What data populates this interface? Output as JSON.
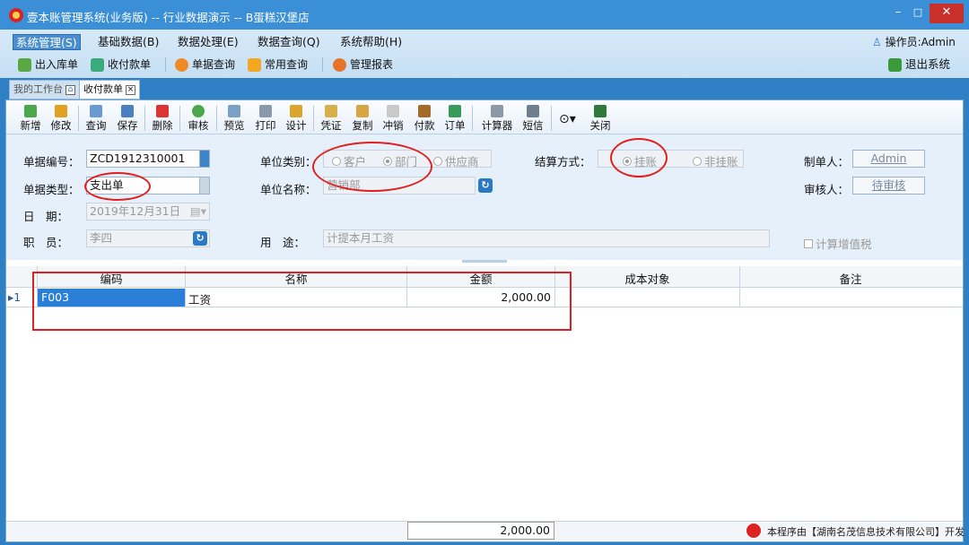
{
  "window": {
    "title": "壹本账管理系统(业务版) -- 行业数据演示 -- B蛋糕汉堡店",
    "minimize": "–",
    "maximize": "□",
    "close": "✕"
  },
  "menu": {
    "items": [
      {
        "label": "系统管理(S)"
      },
      {
        "label": "基础数据(B)"
      },
      {
        "label": "数据处理(E)"
      },
      {
        "label": "数据查询(Q)"
      },
      {
        "label": "系统帮助(H)"
      }
    ],
    "operator": "操作员:Admin"
  },
  "quickbar": {
    "items": [
      {
        "label": "出入库单",
        "icon": "stock-icon"
      },
      {
        "label": "收付款单",
        "icon": "payment-icon"
      },
      {
        "label": "单据查询",
        "icon": "doc-query-icon"
      },
      {
        "label": "常用查询",
        "icon": "chart-icon"
      },
      {
        "label": "管理报表",
        "icon": "report-icon"
      }
    ],
    "exit": "退出系统"
  },
  "tabs": [
    {
      "label": "我的工作台"
    },
    {
      "label": "收付款单"
    }
  ],
  "toolbar": {
    "new": "新增",
    "edit": "修改",
    "query": "查询",
    "save": "保存",
    "delete": "删除",
    "approve": "审核",
    "preview": "预览",
    "print": "打印",
    "design": "设计",
    "voucher": "凭证",
    "copy": "复制",
    "offset": "冲销",
    "pay": "付款",
    "order": "订单",
    "calculator": "计算器",
    "sms": "短信",
    "close": "关闭"
  },
  "form": {
    "doc_no_label": "单据编号：",
    "doc_no": "ZCD1912310001",
    "doc_type_label": "单据类型：",
    "doc_type": "支出单",
    "date_label": "日　期：",
    "date": "2019年12月31日",
    "staff_label": "职　员：",
    "staff": "李四",
    "unit_type_label": "单位类别：",
    "unit_types": [
      "客户",
      "部门",
      "供应商"
    ],
    "unit_type_selected": "部门",
    "unit_name_label": "单位名称：",
    "unit_name": "营销部",
    "purpose_label": "用　途：",
    "purpose": "计提本月工资",
    "settle_label": "结算方式：",
    "settle_options": [
      "挂账",
      "非挂账"
    ],
    "settle_selected": "挂账",
    "maker_label": "制单人：",
    "maker": "Admin",
    "reviewer_label": "审核人：",
    "reviewer": "待审核",
    "vat_label": "计算增值税",
    "vat_checked": false
  },
  "grid": {
    "columns": [
      "编码",
      "名称",
      "金额",
      "成本对象",
      "备注"
    ],
    "rows": [
      {
        "index": "1",
        "code": "F003",
        "name": "工资",
        "amount": "2,000.00",
        "cost_object": "",
        "note": ""
      }
    ],
    "total": "2,000.00"
  },
  "credit": "本程序由【湖南名茂信息技术有限公司】开发",
  "colors": {
    "accent": "#2f7fc4",
    "highlight": "#e02020",
    "selected_cell": "#2b7fd6"
  }
}
